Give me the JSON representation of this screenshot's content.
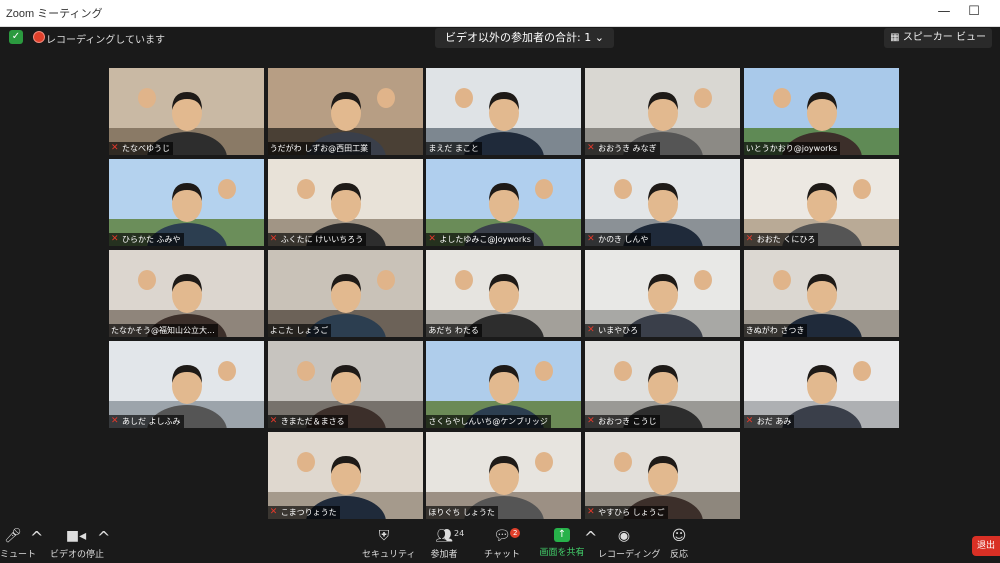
{
  "window": {
    "title": "Zoom ミーティング",
    "minimize": "—",
    "maximize": "☐"
  },
  "topbar": {
    "recording": "レコーディングしています",
    "participant_counter": "ビデオ以外の参加者の合計: 1",
    "counter_caret": "⌄",
    "speaker_view": "スピーカー ビュー"
  },
  "participants": [
    {
      "name": "たなべゆうじ",
      "muted": true
    },
    {
      "name": "うだがわ しずお@西田工業",
      "muted": false,
      "active": true
    },
    {
      "name": "まえだ まこと",
      "muted": false
    },
    {
      "name": "おおうき みなぎ",
      "muted": true
    },
    {
      "name": "いとうかおり@joyworks",
      "muted": false
    },
    {
      "name": "ひらかた ふみや",
      "muted": true
    },
    {
      "name": "ふくたに けいいちろう",
      "muted": true
    },
    {
      "name": "よしたゆみこ@Joyworks",
      "muted": true
    },
    {
      "name": "かのき しんや",
      "muted": true
    },
    {
      "name": "おおた くにひろ",
      "muted": true
    },
    {
      "name": "たなかそう@福知山公立大...",
      "muted": false
    },
    {
      "name": "よこた しょうご",
      "muted": false
    },
    {
      "name": "あだち わたる",
      "muted": false
    },
    {
      "name": "いまやひろ",
      "muted": true
    },
    {
      "name": "きぬがわ さつき",
      "muted": false
    },
    {
      "name": "あしだ よしふみ",
      "muted": true
    },
    {
      "name": "きまただ＆まさる",
      "muted": true
    },
    {
      "name": "さくらやしんいち@ケンブリッジ",
      "muted": false
    },
    {
      "name": "おおつき こうじ",
      "muted": true
    },
    {
      "name": "おだ あみ",
      "muted": true
    },
    {
      "name": "こまつりょうた",
      "muted": true
    },
    {
      "name": "ほりぐち しょうた",
      "muted": false
    },
    {
      "name": "やすひら しょうご",
      "muted": true
    }
  ],
  "toolbar": {
    "mute": "ミュート",
    "video": "ビデオの停止",
    "security": "セキュリティ",
    "participants": "参加者",
    "participants_count": "24",
    "chat": "チャット",
    "chat_badge": "2",
    "share": "画面を共有",
    "record": "レコーディング",
    "reactions": "反応",
    "leave": "退出"
  },
  "colors": {
    "accent_green": "#27b24a",
    "leave_red": "#d93025",
    "active_speaker": "#cfe85a",
    "mute_red": "#e4392b"
  }
}
